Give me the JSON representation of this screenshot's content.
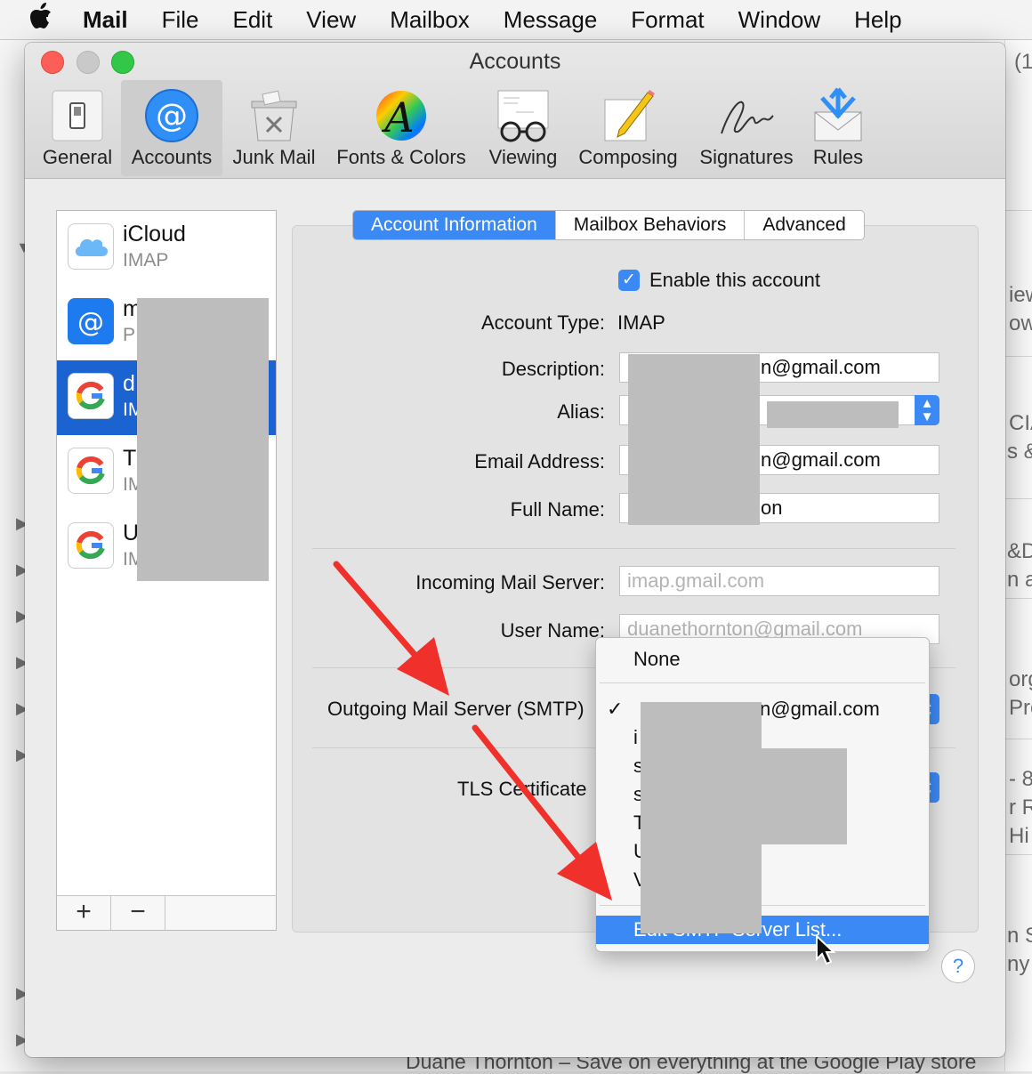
{
  "menubar": {
    "app": "Mail",
    "items": [
      "File",
      "Edit",
      "View",
      "Mailbox",
      "Message",
      "Format",
      "Window",
      "Help"
    ]
  },
  "background": {
    "fragments": [
      "(1",
      "iew",
      "owr",
      "CIA",
      "s &",
      "&D",
      "n ar",
      "org",
      "Pro",
      "- 8",
      "r R",
      "Hi",
      "n St",
      "ny r"
    ],
    "bottom_text": "Duane Thornton – Save on everything at the Google Play store"
  },
  "window": {
    "title": "Accounts"
  },
  "toolbar": {
    "items": [
      {
        "label": "General",
        "icon": "general-switch-icon"
      },
      {
        "label": "Accounts",
        "icon": "at-sign-icon"
      },
      {
        "label": "Junk Mail",
        "icon": "junk-mail-bin-icon"
      },
      {
        "label": "Fonts & Colors",
        "icon": "fonts-colors-icon"
      },
      {
        "label": "Viewing",
        "icon": "viewing-glasses-icon"
      },
      {
        "label": "Composing",
        "icon": "composing-pencil-icon"
      },
      {
        "label": "Signatures",
        "icon": "signature-icon"
      },
      {
        "label": "Rules",
        "icon": "rules-envelope-icon"
      }
    ],
    "selected": "Accounts"
  },
  "accounts": [
    {
      "name": "iCloud",
      "type": "IMAP",
      "icon": "icloud-icon"
    },
    {
      "name": "m",
      "type": "P",
      "icon": "at-sign-icon"
    },
    {
      "name": "d",
      "type": "IM",
      "icon": "google-icon",
      "selected": true
    },
    {
      "name": "T",
      "type": "IM",
      "icon": "google-icon"
    },
    {
      "name": "U",
      "type": "IM",
      "icon": "google-icon"
    }
  ],
  "list_buttons": {
    "add": "+",
    "remove": "−"
  },
  "tabs": [
    "Account Information",
    "Mailbox Behaviors",
    "Advanced"
  ],
  "form": {
    "enable_label": "Enable this account",
    "account_type_label": "Account Type:",
    "account_type_value": "IMAP",
    "description_label": "Description:",
    "description_value": "n@gmail.com",
    "alias_label": "Alias:",
    "email_label": "Email Address:",
    "email_value": "n@gmail.com",
    "fullname_label": "Full Name:",
    "fullname_value": "on",
    "incoming_label": "Incoming Mail Server:",
    "incoming_placeholder": "imap.gmail.com",
    "username_label": "User Name:",
    "username_placeholder": "duanethornton@gmail.com",
    "smtp_label": "Outgoing Mail Server (SMTP)",
    "tls_label": "TLS Certificate"
  },
  "smtp_menu": {
    "none": "None",
    "selected_value": "n@gmail.com",
    "initials": [
      "i",
      "s",
      "s",
      "T",
      "U",
      "V"
    ],
    "edit": "Edit SMTP Server List..."
  },
  "help": "?",
  "colors": {
    "accent": "#3b89f5",
    "selection": "#1b63d0",
    "arrow": "#f0312b"
  }
}
